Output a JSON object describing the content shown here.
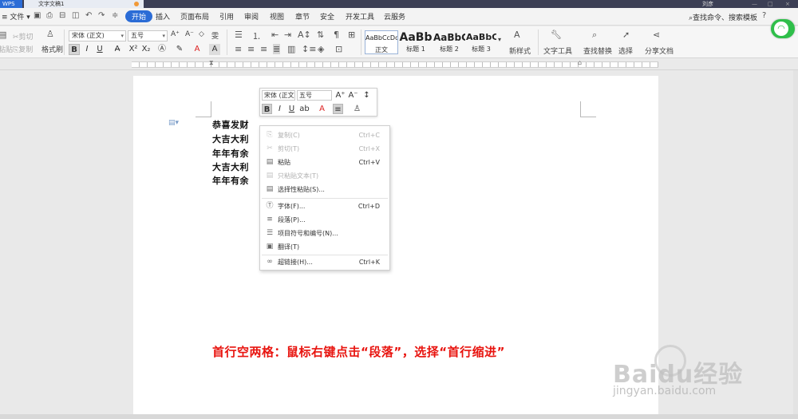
{
  "titlebar": {
    "app_tab": "WPS",
    "doc_tab": "文字文稿1",
    "user": "刘彦",
    "controls": [
      "—",
      "□",
      "×"
    ]
  },
  "menu": {
    "file_label": "文件",
    "tabs": [
      "开始",
      "插入",
      "页面布局",
      "引用",
      "审阅",
      "视图",
      "章节",
      "安全",
      "开发工具",
      "云服务"
    ],
    "active_tab": "开始",
    "search_label": "查找命令、搜索模板",
    "help_icon": "?"
  },
  "ribbon": {
    "cut_label": "剪切",
    "copy_label": "复制",
    "paste_label": "粘贴",
    "format_painter_label": "格式刷",
    "font_name": "宋体 (正文)",
    "font_size": "五号",
    "styles": [
      {
        "sample": "AaBbCcDd",
        "name": "正文"
      },
      {
        "sample": "AaBb",
        "name": "标题 1"
      },
      {
        "sample": "AaBbC",
        "name": "标题 2"
      },
      {
        "sample": "AaBbC",
        "name": "标题 3"
      }
    ],
    "new_style_label": "新样式",
    "text_tools_label": "文字工具",
    "find_replace_label": "查找替换",
    "select_label": "选择",
    "share_label": "分享文档"
  },
  "document": {
    "lines": [
      "恭喜发财",
      "大吉大利",
      "年年有余",
      "大吉大利",
      "年年有余"
    ]
  },
  "mini_toolbar": {
    "font_name": "宋体 (正文",
    "font_size": "五号"
  },
  "context_menu": {
    "items": [
      {
        "icon": "copy-icon",
        "glyph": "⎘",
        "label": "复制(C)",
        "shortcut": "Ctrl+C",
        "disabled": true
      },
      {
        "icon": "cut-icon",
        "glyph": "✂",
        "label": "剪切(T)",
        "shortcut": "Ctrl+X",
        "disabled": true
      },
      {
        "icon": "paste-icon",
        "glyph": "▤",
        "label": "粘贴",
        "shortcut": "Ctrl+V",
        "disabled": false
      },
      {
        "icon": "paste-text-icon",
        "glyph": "▤",
        "label": "只粘贴文本(T)",
        "shortcut": "",
        "disabled": true
      },
      {
        "icon": "paste-special-icon",
        "glyph": "▤",
        "label": "选择性粘贴(S)...",
        "shortcut": "",
        "disabled": false
      },
      {
        "icon": "font-icon",
        "glyph": "Ⓣ",
        "label": "字体(F)...",
        "shortcut": "Ctrl+D",
        "disabled": false
      },
      {
        "icon": "paragraph-icon",
        "glyph": "≡",
        "label": "段落(P)...",
        "shortcut": "",
        "disabled": false
      },
      {
        "icon": "bullets-icon",
        "glyph": "☰",
        "label": "项目符号和编号(N)...",
        "shortcut": "",
        "disabled": false
      },
      {
        "icon": "translate-icon",
        "glyph": "▣",
        "label": "翻译(T)",
        "shortcut": "",
        "disabled": false
      },
      {
        "icon": "hyperlink-icon",
        "glyph": "∞",
        "label": "超链接(H)...",
        "shortcut": "Ctrl+K",
        "disabled": false
      }
    ]
  },
  "annotation": "首行空两格：鼠标右键点击“段落”，选择“首行缩进”",
  "watermark": {
    "text": "Baidu经验",
    "url": "jingyan.baidu.com"
  },
  "colors": {
    "accent": "#2b6cd6",
    "annotation": "#e8140f",
    "wifi": "#2fbf4a"
  }
}
